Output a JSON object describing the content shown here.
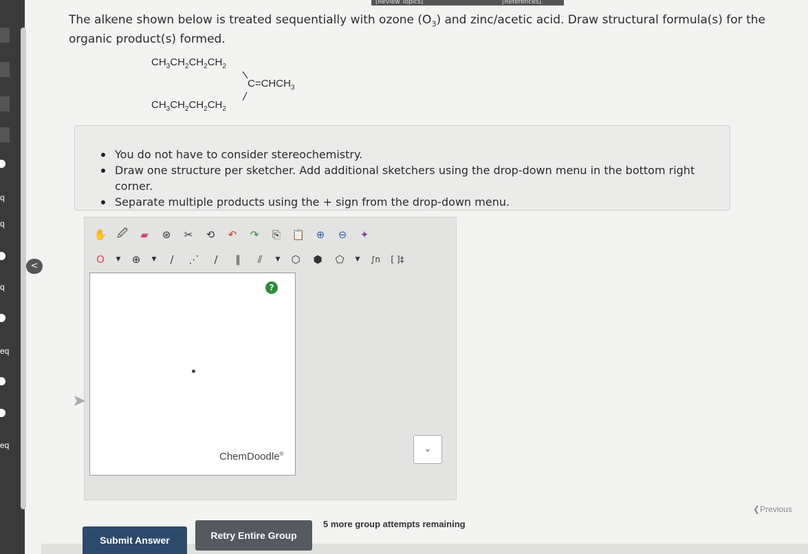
{
  "header": {
    "review_topics": "[Review Topics]",
    "references": "[References]"
  },
  "question": {
    "text_before": "The alkene shown below is treated sequentially with ozone (O",
    "sub": "3",
    "text_after": ") and zinc/acetic acid. Draw structural formula(s) for the organic product(s) formed."
  },
  "structure": {
    "upper_chain": "CH3CH2CH2CH2",
    "lower_chain": "CH3CH2CH2CH2",
    "double_bond": "C=CHCH3"
  },
  "instructions": [
    "You do not have to consider stereochemistry.",
    "Draw one structure per sketcher. Add additional sketchers using the drop-down menu in the bottom right corner.",
    "Separate multiple products using the + sign from the drop-down menu."
  ],
  "sketcher": {
    "toolbar_row1": [
      "hand-icon",
      "lasso-icon",
      "eraser-icon",
      "ring-template-icon",
      "cut-icon",
      "scissors-icon",
      "undo-icon",
      "redo-icon",
      "copy-icon",
      "paste-icon",
      "zoom-in-icon",
      "zoom-out-icon",
      "clean-icon"
    ],
    "toolbar_row2": [
      "O",
      "⊕",
      "/",
      "⋰",
      "∕",
      "∥",
      "⫽",
      "⬡",
      "⬢",
      "⬠",
      "∫n",
      "[ ]‡"
    ],
    "help_label": "?",
    "brand": "ChemDoodle",
    "brand_mark": "®",
    "add_sketcher_icon": "⌄"
  },
  "sidebar": {
    "labels": [
      "q",
      "q",
      "q",
      "eq",
      "eq"
    ],
    "collapse_label": "<"
  },
  "buttons": {
    "submit": "Submit Answer",
    "retry": "Retry Entire Group"
  },
  "attempts_text": "5 more group attempts remaining",
  "previous_label": "Previous"
}
